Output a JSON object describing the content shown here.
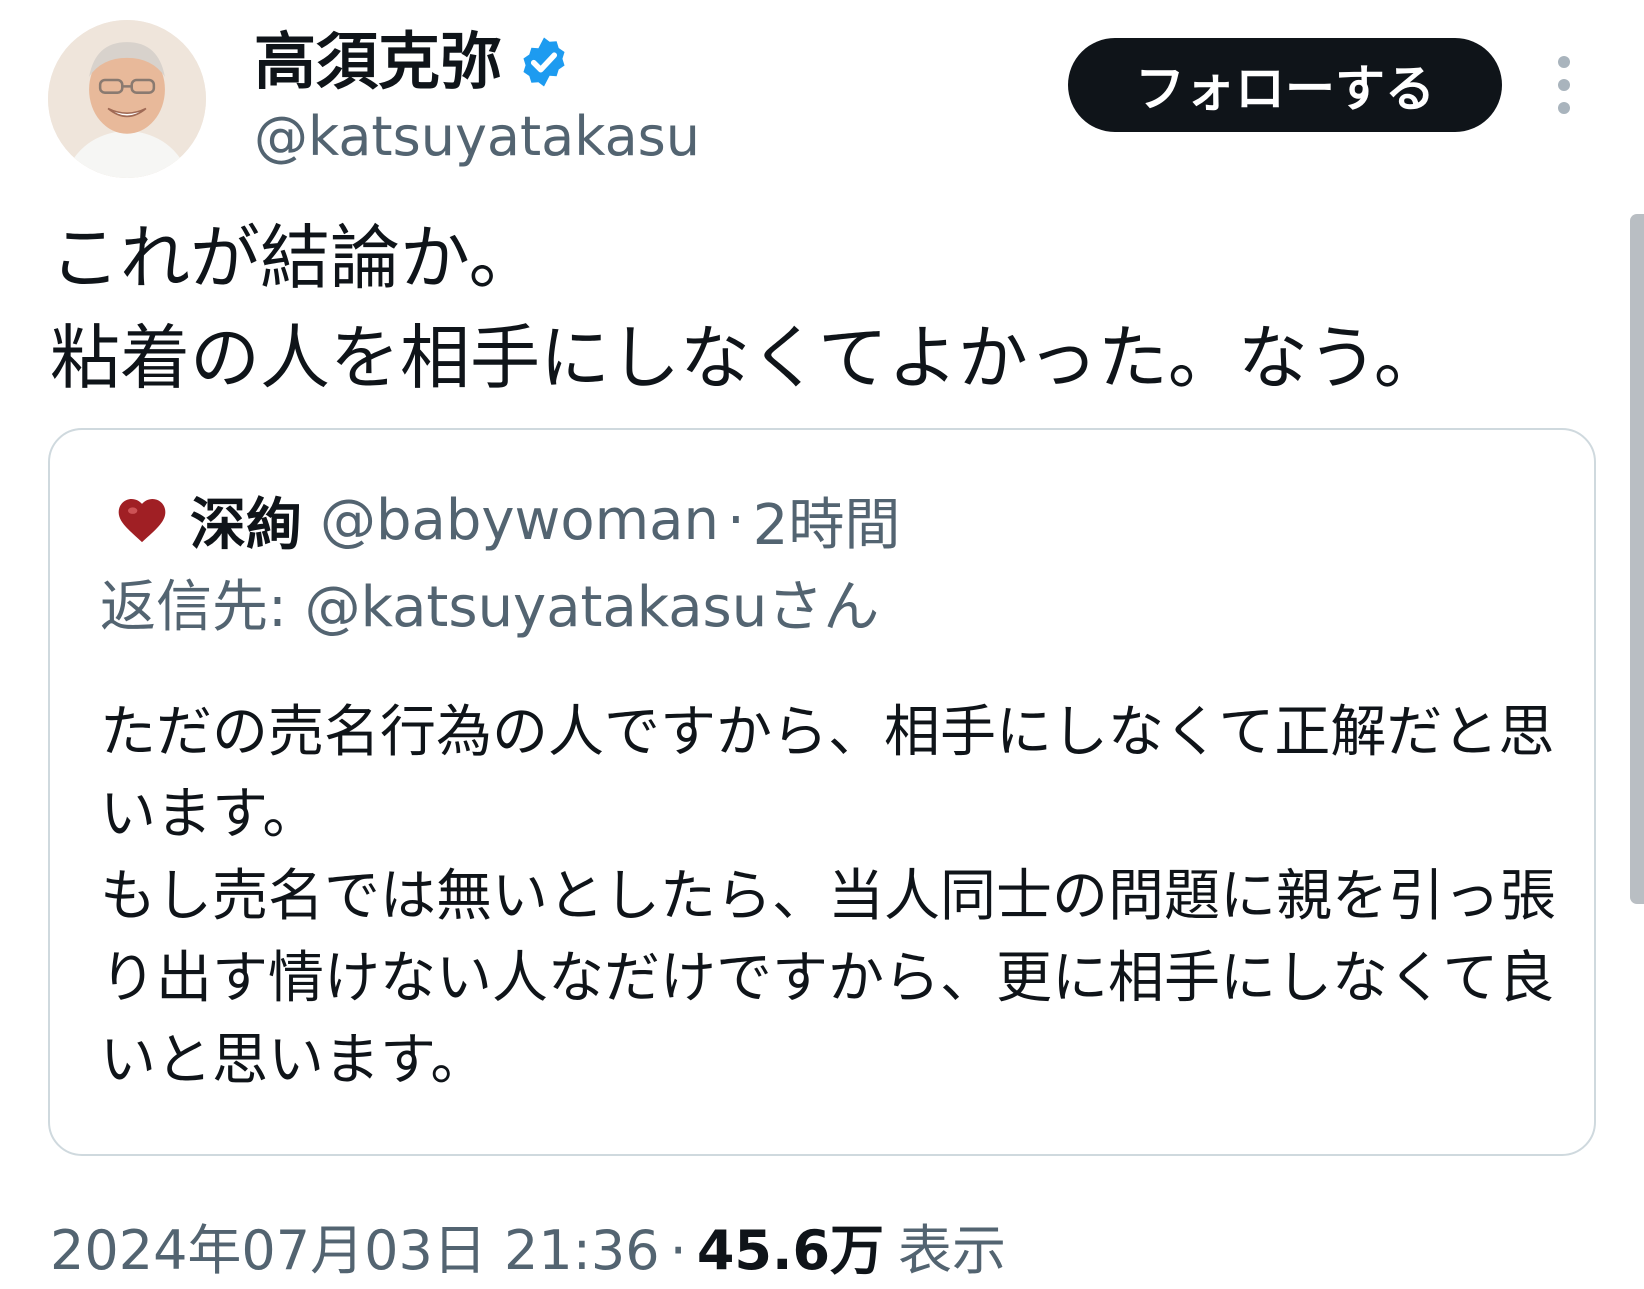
{
  "tweet": {
    "author": {
      "display_name": "高須克弥",
      "handle": "@katsuyatakasu",
      "verified": true,
      "avatar_icon": "person-avatar"
    },
    "follow_label": "フォローする",
    "text": "これが結論か。\n粘着の人を相手にしなくてよかった。なう。",
    "quoted": {
      "display_name": "深絢",
      "handle": "@babywoman",
      "separator": "·",
      "time": "2時間",
      "avatar_icon": "heart-avatar",
      "reply_to": "返信先: @katsuyatakasuさん",
      "text": "ただの売名行為の人ですから、相手にしなくて正解だと思います。\nもし売名では無いとしたら、当人同士の問題に親を引っ張り出す情けない人なだけですから、更に相手にしなくて良いと思います。"
    },
    "timestamp": "2024年07月03日 21:36",
    "separator": "·",
    "views_count": "45.6万",
    "views_label": "表示"
  },
  "colors": {
    "text_primary": "#0f1419",
    "text_secondary": "#536471",
    "verified_blue": "#1d9bf0",
    "border": "#cfd9de",
    "button_bg": "#0f1419"
  }
}
